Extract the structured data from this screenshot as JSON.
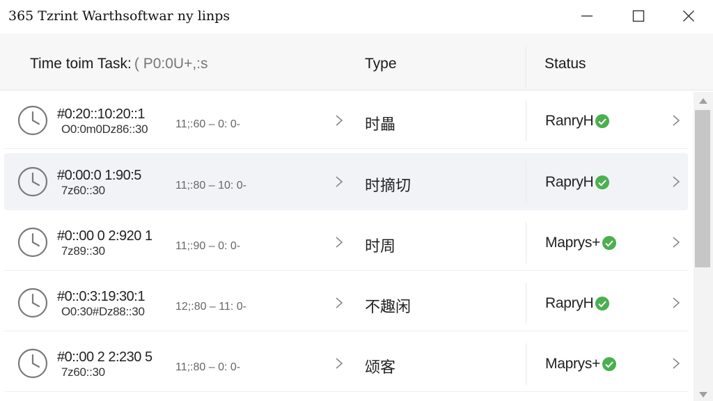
{
  "window": {
    "title": "365 Tzrint Warthsoftwar ny linps"
  },
  "header": {
    "time_label": "Time toim Task:",
    "time_extra": "( P0:0U+,:s",
    "type_label": "Type",
    "status_label": "Status"
  },
  "rows": [
    {
      "time_main": "#0:20::10:20::1",
      "time_sub": "O0:0m0Dz86::30",
      "time_range": "11;:60 – 0: 0-",
      "type": "时畾",
      "status": "RanryH"
    },
    {
      "time_main": "#0:00:0 1:90:5",
      "time_sub": "7z60::30",
      "time_range": "11;:80 – 10: 0-",
      "type": "时摘切",
      "status": "RapryH"
    },
    {
      "time_main": "#0::00 0 2:920 1",
      "time_sub": "7z89::30",
      "time_range": "11;:90 – 0: 0-",
      "type": "时周",
      "status": "Maprys+"
    },
    {
      "time_main": "#0::0:3:19:30:1",
      "time_sub": "O0:30#Dz88::30",
      "time_range": "12;:80 – 11: 0-",
      "type": "不趣闲",
      "status": "RapryH"
    },
    {
      "time_main": "#0::00 2 2:230 5",
      "time_sub": "7z60::30",
      "time_range": "11;:80 – 0: 0-",
      "type": "颂客",
      "status": "Maprys+"
    }
  ],
  "icons": {
    "clock": "clock-icon",
    "check": "check-circle-icon",
    "chevron": "chevron-right-icon"
  },
  "colors": {
    "status_check": "#4caf50",
    "selected_row": "#f1f3f7",
    "header_bg": "#f7f7f7",
    "scroll_thumb": "#c6c6c6"
  },
  "ui": {
    "selected_row_index": 1
  }
}
